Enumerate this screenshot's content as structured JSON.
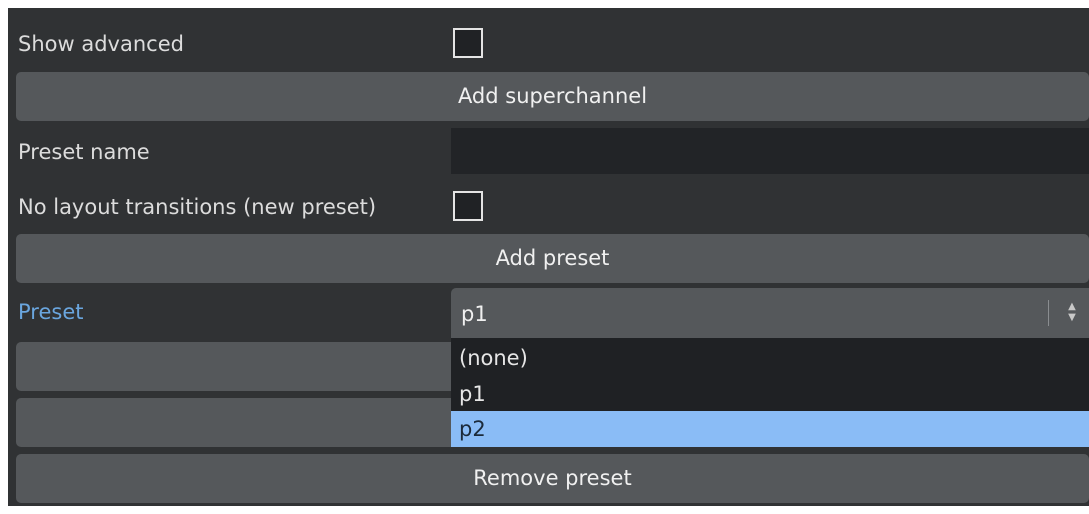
{
  "form": {
    "show_advanced_label": "Show advanced",
    "add_superchannel_label": "Add superchannel",
    "preset_name_label": "Preset name",
    "preset_name_value": "",
    "no_layout_transitions_label": "No layout transitions (new preset)",
    "add_preset_label": "Add preset",
    "preset_label": "Preset",
    "preset_selected": "p1",
    "remove_preset_label": "Remove preset"
  },
  "dropdown": {
    "options": [
      "(none)",
      "p1",
      "p2"
    ],
    "highlighted": "p2"
  },
  "icons": {
    "select_spinner": "up-down-arrows-icon"
  },
  "colors": {
    "panel_bg": "#303234",
    "button_bg": "#55585b",
    "input_bg": "#222427",
    "accent_label": "#6aa6df",
    "highlight": "#8abcf6"
  }
}
